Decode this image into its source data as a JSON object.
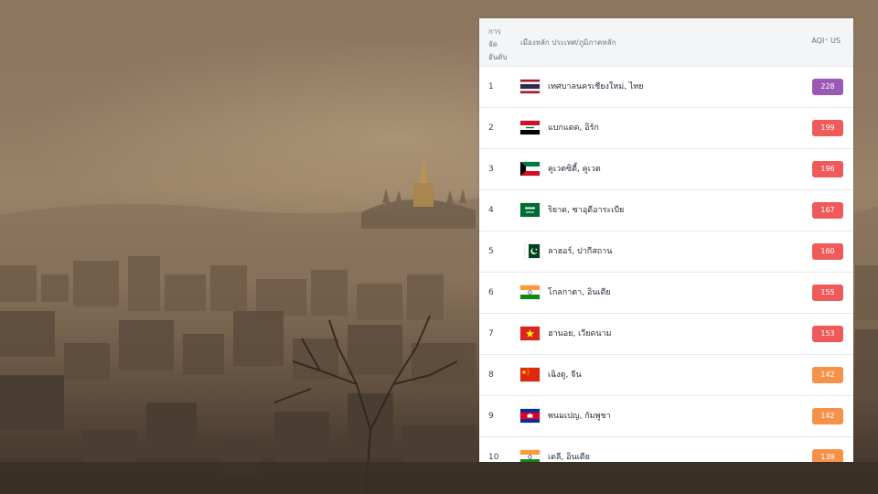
{
  "table": {
    "header": {
      "rank_lines": [
        "การ",
        "จัด",
        "อันดับ"
      ],
      "city": "เมืองหลัก ประเทศ/ภูมิภาคหลัก",
      "aqi": "AQI⁺ US"
    },
    "rows": [
      {
        "rank": "1",
        "city": "เทศบาลนครเชียงใหม่, ไทย",
        "flag": "thailand-flag",
        "aqi": "228",
        "color": "#9b59b6"
      },
      {
        "rank": "2",
        "city": "แบกแดด, อิรัก",
        "flag": "iraq-flag",
        "aqi": "199",
        "color": "#ef5b5b"
      },
      {
        "rank": "3",
        "city": "คูเวตซิตี้, คูเวต",
        "flag": "kuwait-flag",
        "aqi": "196",
        "color": "#ef5b5b"
      },
      {
        "rank": "4",
        "city": "ริยาด, ซาอุดีอาระเบีย",
        "flag": "saudi-arabia-flag",
        "aqi": "167",
        "color": "#ef5b5b"
      },
      {
        "rank": "5",
        "city": "ลาฮอร์, ปากีสถาน",
        "flag": "pakistan-flag",
        "aqi": "160",
        "color": "#ef5b5b"
      },
      {
        "rank": "6",
        "city": "โกลกาตา, อินเดีย",
        "flag": "india-flag",
        "aqi": "155",
        "color": "#ef5b5b"
      },
      {
        "rank": "7",
        "city": "ฮานอย, เวียดนาม",
        "flag": "vietnam-flag",
        "aqi": "153",
        "color": "#ef5b5b"
      },
      {
        "rank": "8",
        "city": "เฉิงตู, จีน",
        "flag": "china-flag",
        "aqi": "142",
        "color": "#f5924a"
      },
      {
        "rank": "9",
        "city": "พนมเปญ, กัมพูชา",
        "flag": "cambodia-flag",
        "aqi": "142",
        "color": "#f5924a"
      },
      {
        "rank": "10",
        "city": "เดลี, อินเดีย",
        "flag": "india-flag",
        "aqi": "139",
        "color": "#f5924a"
      }
    ]
  }
}
